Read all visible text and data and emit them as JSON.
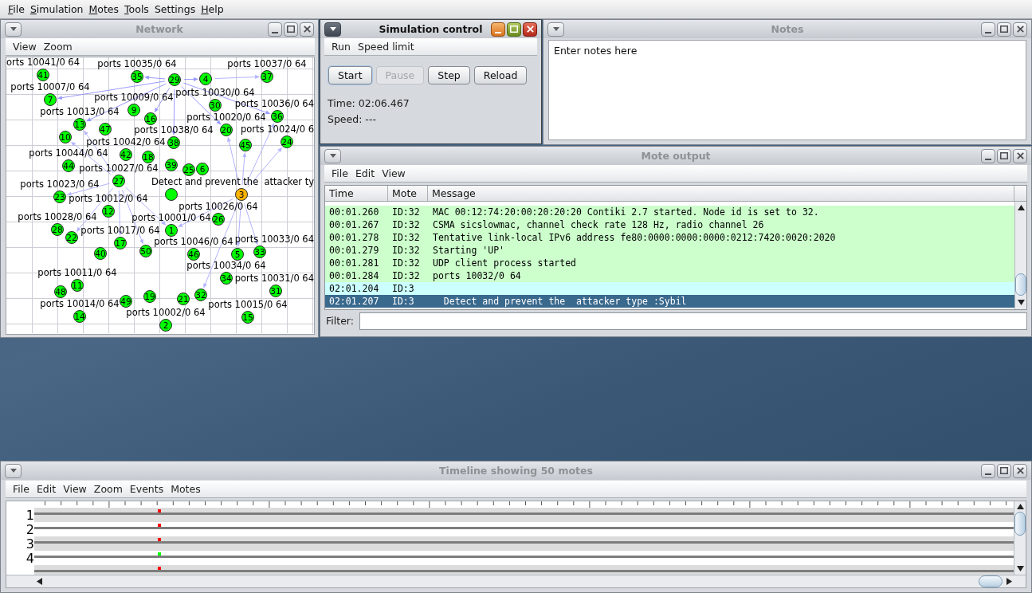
{
  "menu_bar": [
    {
      "label": "File",
      "mnemonic": true
    },
    {
      "label": "Simulation",
      "mnemonic": true
    },
    {
      "label": "Motes",
      "mnemonic": true
    },
    {
      "label": "Tools",
      "mnemonic": true
    },
    {
      "label": "Settings",
      "mnemonic": false
    },
    {
      "label": "Help",
      "mnemonic": true
    }
  ],
  "network_window": {
    "title": "Network",
    "active": false,
    "menus": [
      "View",
      "Zoom"
    ],
    "motes": [
      {
        "id": "41",
        "label": "orts 10041/0 64",
        "color": "#00ff00"
      },
      {
        "id": "35",
        "label": "ports 10035/0 64",
        "color": "#00ff00"
      },
      {
        "id": "29",
        "color": "#00ff00"
      },
      {
        "id": "4",
        "color": "#00ff00"
      },
      {
        "id": "37",
        "label": "ports 10037/0 64",
        "color": "#00ff00"
      },
      {
        "id": "7",
        "label": "ports 10007/0 64",
        "color": "#00ff00"
      },
      {
        "id": "9",
        "label": "ports 10009/0 64",
        "color": "#00ff00"
      },
      {
        "id": "30",
        "label": "ports 10030/0 64",
        "color": "#00ff00"
      },
      {
        "id": "13",
        "label": "ports 10013/0 64",
        "color": "#00ff00"
      },
      {
        "id": "10",
        "color": "#00ff00"
      },
      {
        "id": "47",
        "color": "#00ff00"
      },
      {
        "id": "16",
        "color": "#00ff00"
      },
      {
        "id": "44",
        "label": "ports 10044/0 64",
        "color": "#00ff00"
      },
      {
        "id": "42",
        "label": "ports 10042/0 64",
        "color": "#00ff00"
      },
      {
        "id": "38",
        "label": "ports 10038/0 64",
        "color": "#00ff00"
      },
      {
        "id": "20",
        "label": "ports 10020/0 64",
        "color": "#00ff00"
      },
      {
        "id": "36",
        "label": "ports 10036/0 64",
        "color": "#00ff00"
      },
      {
        "id": "45",
        "color": "#00ff00"
      },
      {
        "id": "24",
        "label": "ports 10024/0 6",
        "color": "#00ff00"
      },
      {
        "id": "18",
        "color": "#00ff00"
      },
      {
        "id": "27",
        "label": "ports 10027/0 64",
        "color": "#00ff00"
      },
      {
        "id": "39",
        "color": "#00ff00"
      },
      {
        "id": "25",
        "color": "#00ff00"
      },
      {
        "id": "6",
        "color": "#00ff00"
      },
      {
        "id": "23",
        "label": "ports 10023/0 64",
        "color": "#00ff00"
      },
      {
        "id": "12",
        "label": "ports 10012/0 64",
        "color": "#00ff00"
      },
      {
        "color": "#00ff00"
      },
      {
        "id": "3",
        "label": "Detect and prevent the  attacker ty",
        "color": "#ffb400"
      },
      {
        "id": "28",
        "label": "ports 10028/0 64",
        "color": "#00ff00"
      },
      {
        "id": "22",
        "color": "#00ff00"
      },
      {
        "id": "17",
        "label": "ports 10017/0 64",
        "color": "#00ff00"
      },
      {
        "id": "1",
        "label": "ports 10001/0 64",
        "color": "#00ff00"
      },
      {
        "id": "26",
        "label": "ports 10026/0 64",
        "color": "#00ff00"
      },
      {
        "id": "40",
        "color": "#00ff00"
      },
      {
        "id": "50",
        "color": "#00ff00"
      },
      {
        "id": "46",
        "label": "ports 10046/0 64",
        "color": "#00ff00"
      },
      {
        "id": "5",
        "color": "#00ff00"
      },
      {
        "id": "33",
        "label": "ports 10033/0 64",
        "color": "#00ff00"
      },
      {
        "id": "11",
        "label": "ports 10011/0 64",
        "color": "#00ff00"
      },
      {
        "id": "34",
        "label": "ports 10034/0 64",
        "color": "#00ff00"
      },
      {
        "id": "48",
        "color": "#00ff00"
      },
      {
        "id": "14",
        "label": "ports 10014/0 64",
        "color": "#00ff00"
      },
      {
        "id": "49",
        "color": "#00ff00"
      },
      {
        "id": "19",
        "color": "#00ff00"
      },
      {
        "id": "21",
        "color": "#00ff00"
      },
      {
        "id": "32",
        "color": "#00ff00"
      },
      {
        "id": "31",
        "label": "ports 10031/0 64",
        "color": "#00ff00"
      },
      {
        "id": "2",
        "label": "ports 10002/0 64",
        "color": "#00ff00"
      },
      {
        "id": "15",
        "label": "ports 10015/0 64",
        "color": "#00ff00"
      }
    ]
  },
  "simulation_control_window": {
    "title": "Simulation control",
    "active": true,
    "menus": [
      "Run",
      "Speed limit"
    ],
    "buttons": [
      {
        "label": "Start",
        "disabled": false,
        "focused": true
      },
      {
        "label": "Pause",
        "disabled": true,
        "focused": false
      },
      {
        "label": "Step",
        "disabled": false,
        "focused": false
      },
      {
        "label": "Reload",
        "disabled": false,
        "focused": false
      }
    ],
    "time": "Time: 02:06.467",
    "speed": "Speed: ---"
  },
  "notes_window": {
    "title": "Notes",
    "active": false,
    "text": "Enter notes here"
  },
  "mote_output_window": {
    "title": "Mote output",
    "active": false,
    "menus": [
      "File",
      "Edit",
      "View"
    ],
    "columns": [
      "Time",
      "Mote",
      "Message"
    ],
    "rows": [
      {
        "time": "00:01.260",
        "mote": "ID:32",
        "message": "MAC 00:12:74:20:00:20:20:20 Contiki 2.7 started. Node id is set to 32.",
        "color": "#ccffcc",
        "selected": false
      },
      {
        "time": "00:01.267",
        "mote": "ID:32",
        "message": "CSMA sicslowmac, channel check rate 128 Hz, radio channel 26",
        "color": "#ccffcc",
        "selected": false
      },
      {
        "time": "00:01.278",
        "mote": "ID:32",
        "message": "Tentative link-local IPv6 address fe80:0000:0000:0000:0212:7420:0020:2020",
        "color": "#ccffcc",
        "selected": false
      },
      {
        "time": "00:01.279",
        "mote": "ID:32",
        "message": "Starting 'UP'",
        "color": "#ccffcc",
        "selected": false
      },
      {
        "time": "00:01.281",
        "mote": "ID:32",
        "message": "UDP client process started",
        "color": "#ccffcc",
        "selected": false
      },
      {
        "time": "00:01.284",
        "mote": "ID:32",
        "message": "ports 10032/0 64",
        "color": "#ccffcc",
        "selected": false
      },
      {
        "time": "02:01.204",
        "mote": "ID:3",
        "color": "#ccffff",
        "selected": false
      },
      {
        "time": "02:01.207",
        "mote": "ID:3",
        "message": "  Detect and prevent the  attacker type :Sybil",
        "selected": true
      }
    ],
    "filter_label": "Filter:"
  },
  "timeline_window": {
    "title": "Timeline showing 50 motes",
    "active": false,
    "menus": [
      "File",
      "Edit",
      "View",
      "Zoom",
      "Events",
      "Motes"
    ],
    "rows": [
      {
        "label": "1",
        "color": "#ff0000"
      },
      {
        "label": "2",
        "color": "#ff0000"
      },
      {
        "label": "3",
        "color": "#ff0000"
      },
      {
        "label": "4",
        "color": "#00ff00"
      },
      {
        "color": "#ff0000"
      }
    ]
  }
}
